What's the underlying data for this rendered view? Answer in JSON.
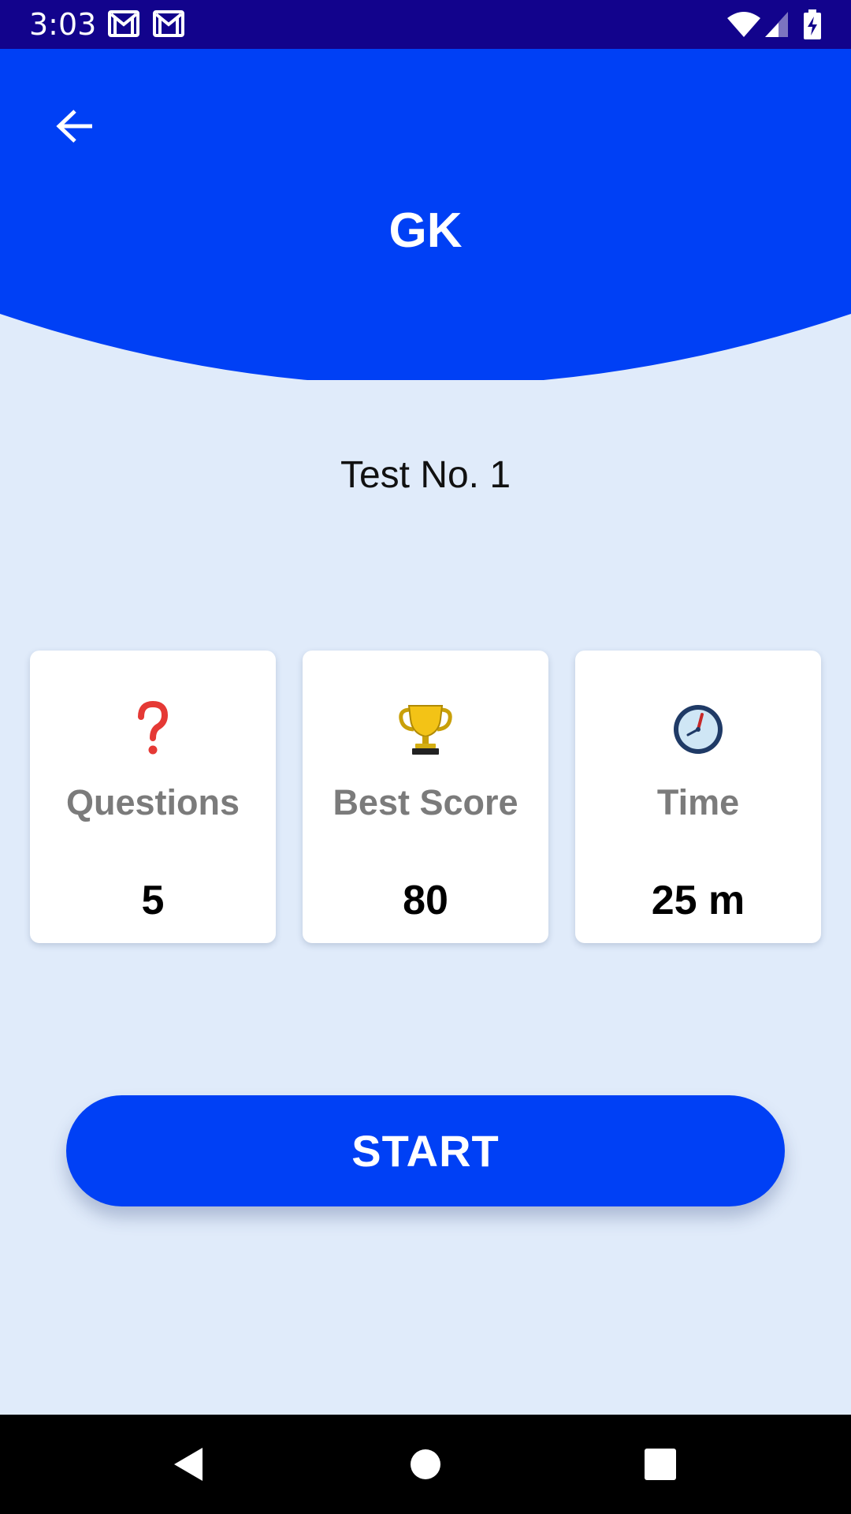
{
  "status_bar": {
    "time": "3:03",
    "icons": [
      "gmail-icon",
      "gmail-icon",
      "wifi-icon",
      "signal-icon",
      "battery-charging-icon"
    ],
    "background": "#12038C"
  },
  "header": {
    "title": "GK",
    "back_icon": "arrow-left-icon",
    "background": "#0040F5"
  },
  "test_label": "Test No. 1",
  "stats": [
    {
      "icon": "question-mark-icon",
      "label": "Questions",
      "value": "5"
    },
    {
      "icon": "trophy-icon",
      "label": "Best Score",
      "value": "80"
    },
    {
      "icon": "clock-icon",
      "label": "Time",
      "value": "25 m"
    }
  ],
  "start_button": {
    "label": "START",
    "color": "#0040F5"
  },
  "nav_bar": {
    "icons": [
      "back-triangle-icon",
      "home-circle-icon",
      "recents-square-icon"
    ]
  },
  "colors": {
    "page_background": "#E0EBFA",
    "card_label": "#7B7B7B",
    "card_value": "#000000"
  }
}
